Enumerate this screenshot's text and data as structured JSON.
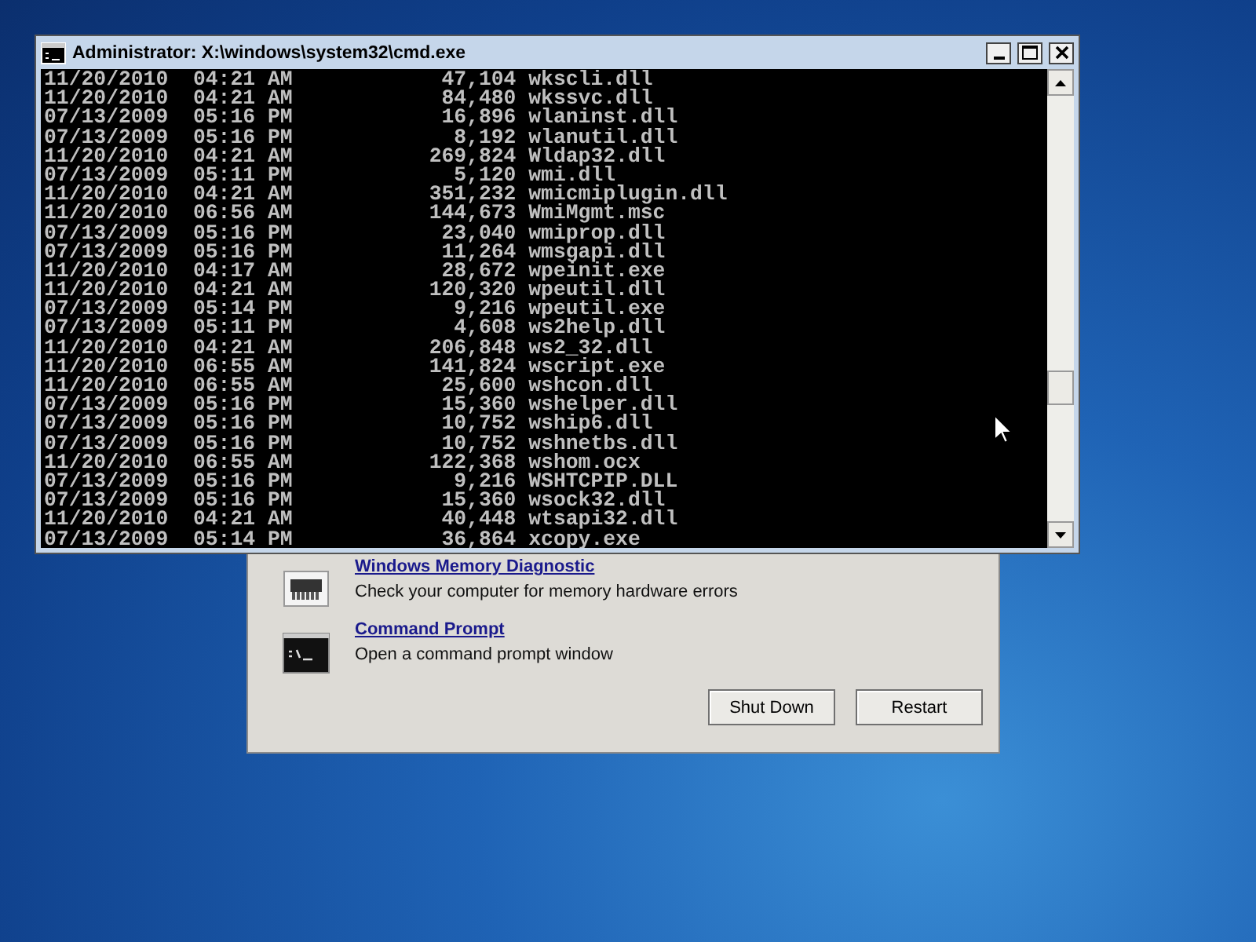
{
  "recovery_dialog": {
    "items": [
      {
        "kind": "memory",
        "title": "Windows Memory Diagnostic",
        "description": "Check your computer for memory hardware errors"
      },
      {
        "kind": "cmd",
        "title": "Command Prompt",
        "description": "Open a command prompt window"
      }
    ],
    "buttons": [
      "Shut Down",
      "Restart"
    ]
  },
  "console_window": {
    "title": "Administrator: X:\\windows\\system32\\cmd.exe",
    "lines": [
      "11/20/2010  04:21 AM            47,104 wkscli.dll",
      "11/20/2010  04:21 AM            84,480 wkssvc.dll",
      "07/13/2009  05:16 PM            16,896 wlaninst.dll",
      "07/13/2009  05:16 PM             8,192 wlanutil.dll",
      "11/20/2010  04:21 AM           269,824 Wldap32.dll",
      "07/13/2009  05:11 PM             5,120 wmi.dll",
      "11/20/2010  04:21 AM           351,232 wmicmiplugin.dll",
      "11/20/2010  06:56 AM           144,673 WmiMgmt.msc",
      "07/13/2009  05:16 PM            23,040 wmiprop.dll",
      "07/13/2009  05:16 PM            11,264 wmsgapi.dll",
      "11/20/2010  04:17 AM            28,672 wpeinit.exe",
      "11/20/2010  04:21 AM           120,320 wpeutil.dll",
      "07/13/2009  05:14 PM             9,216 wpeutil.exe",
      "07/13/2009  05:11 PM             4,608 ws2help.dll",
      "11/20/2010  04:21 AM           206,848 ws2_32.dll",
      "11/20/2010  06:55 AM           141,824 wscript.exe",
      "11/20/2010  06:55 AM            25,600 wshcon.dll",
      "07/13/2009  05:16 PM            15,360 wshelper.dll",
      "07/13/2009  05:16 PM            10,752 wship6.dll",
      "07/13/2009  05:16 PM            10,752 wshnetbs.dll",
      "11/20/2010  06:55 AM           122,368 wshom.ocx",
      "07/13/2009  05:16 PM             9,216 WSHTCPIP.DLL",
      "07/13/2009  05:16 PM            15,360 wsock32.dll",
      "11/20/2010  04:21 AM            40,448 wtsapi32.dll",
      "07/13/2009  05:14 PM            36,864 xcopy.exe"
    ]
  }
}
